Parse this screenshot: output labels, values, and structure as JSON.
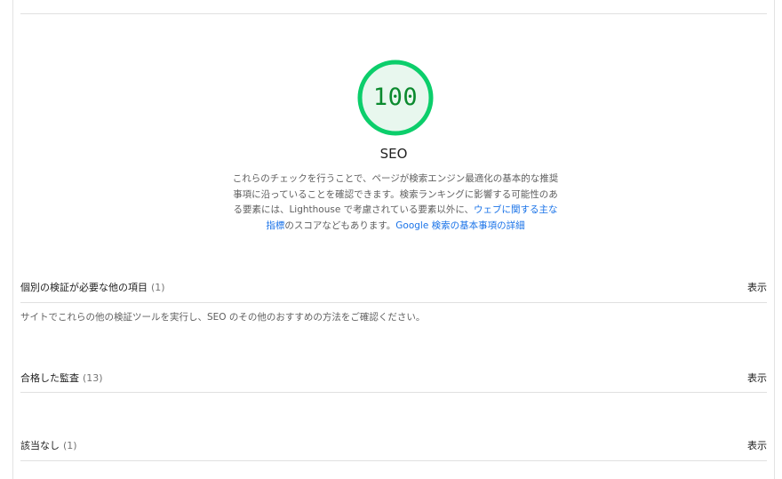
{
  "score": {
    "value": "100",
    "color": "#0cce6b",
    "fill": "#e8f7ee",
    "text_color": "#0b8a2e"
  },
  "category": {
    "title": "SEO",
    "description_parts": [
      {
        "text": "これらのチェックを行うことで、ページが検索エンジン最適化の基本的な推奨事項に沿っていることを確認できます。検索ランキングに影響する可能性のある要素には、Lighthouse で考慮されている要素以外に、",
        "link": false
      },
      {
        "text": "ウェブに関する主な指標",
        "link": true
      },
      {
        "text": "のスコアなどもあります。",
        "link": false
      },
      {
        "text": "Google 検索の基本事項の詳細",
        "link": true
      }
    ]
  },
  "groups": [
    {
      "title": "個別の検証が必要な他の項目",
      "count": "(1)",
      "toggle": "表示",
      "description": "サイトでこれらの他の検証ツールを実行し、SEO のその他のおすすめの方法をご確認ください。"
    },
    {
      "title": "合格した監査",
      "count": "(13)",
      "toggle": "表示"
    },
    {
      "title": "該当なし",
      "count": "(1)",
      "toggle": "表示"
    }
  ]
}
